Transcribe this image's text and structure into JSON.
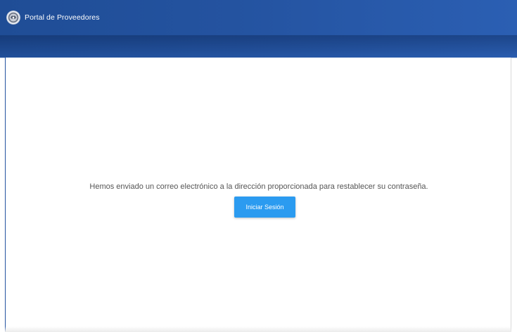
{
  "app_bar": {
    "title": "Portal de Proveedores",
    "logo_icon": "seal-logo-icon",
    "colors": {
      "primary": "#2453a0",
      "accent": "#2b9bf0"
    }
  },
  "main": {
    "message": "Hemos enviado un correo electrónico a la dirección proporcionada para restablecer su contraseña.",
    "login_button_label": "Iniciar Sesión"
  }
}
